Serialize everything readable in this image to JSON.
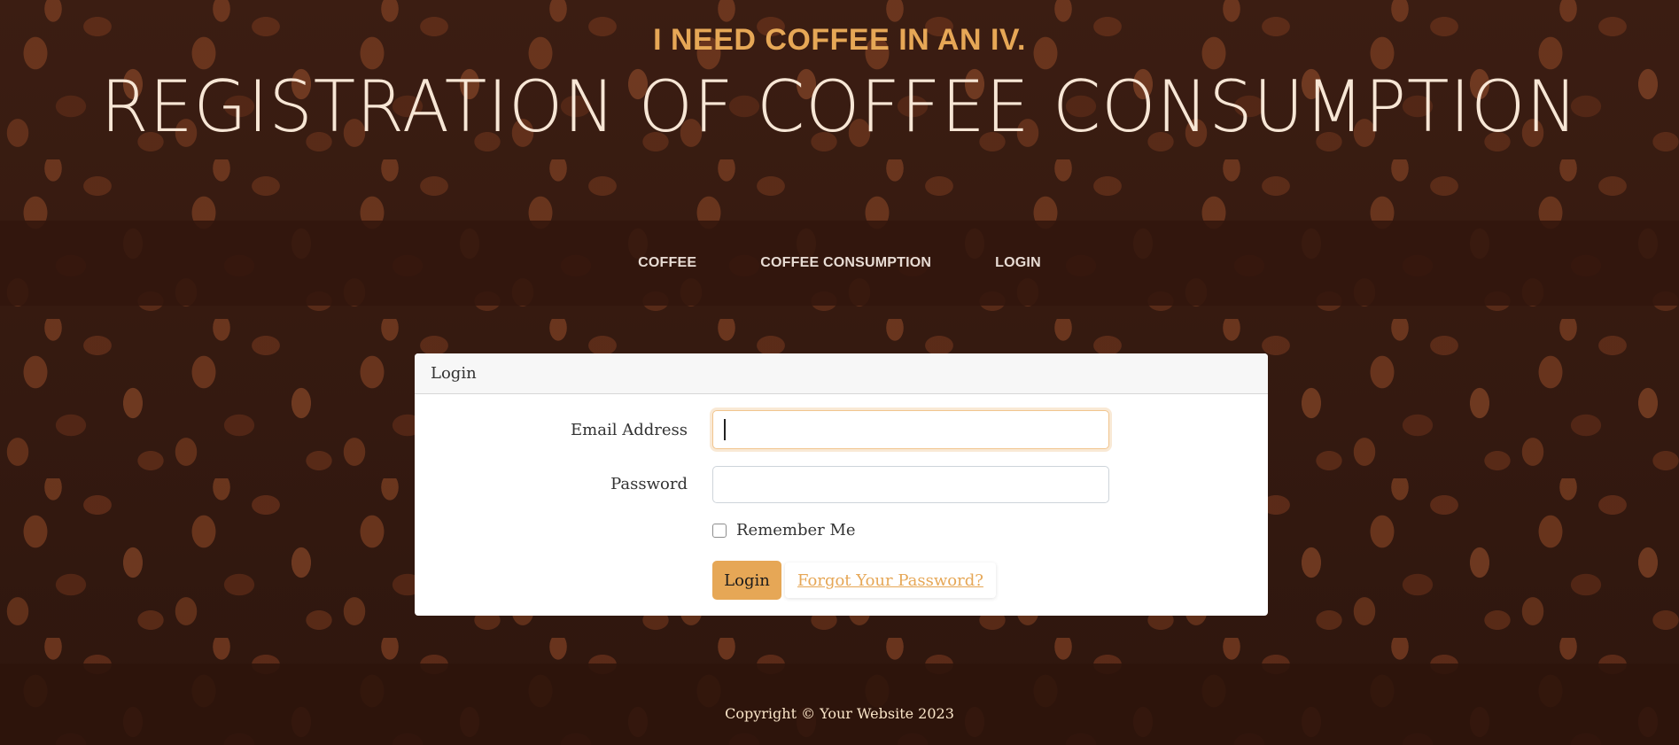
{
  "heading": {
    "upper": "I NEED COFFEE IN AN IV.",
    "lower": "REGISTRATION OF COFFEE CONSUMPTION"
  },
  "nav": {
    "items": [
      {
        "label": "COFFEE"
      },
      {
        "label": "COFFEE CONSUMPTION"
      },
      {
        "label": "LOGIN"
      }
    ]
  },
  "login_card": {
    "header": "Login",
    "email_label": "Email Address",
    "email_value": "",
    "password_label": "Password",
    "password_value": "",
    "remember_label": "Remember Me",
    "remember_checked": false,
    "login_button": "Login",
    "forgot_link": "Forgot Your Password?"
  },
  "footer": {
    "text": "Copyright © Your Website 2023"
  },
  "colors": {
    "accent": "#e6a756",
    "heading_light": "#f7e6d5",
    "nav_bg": "#32160c",
    "footer_text": "#fbe6c9"
  }
}
